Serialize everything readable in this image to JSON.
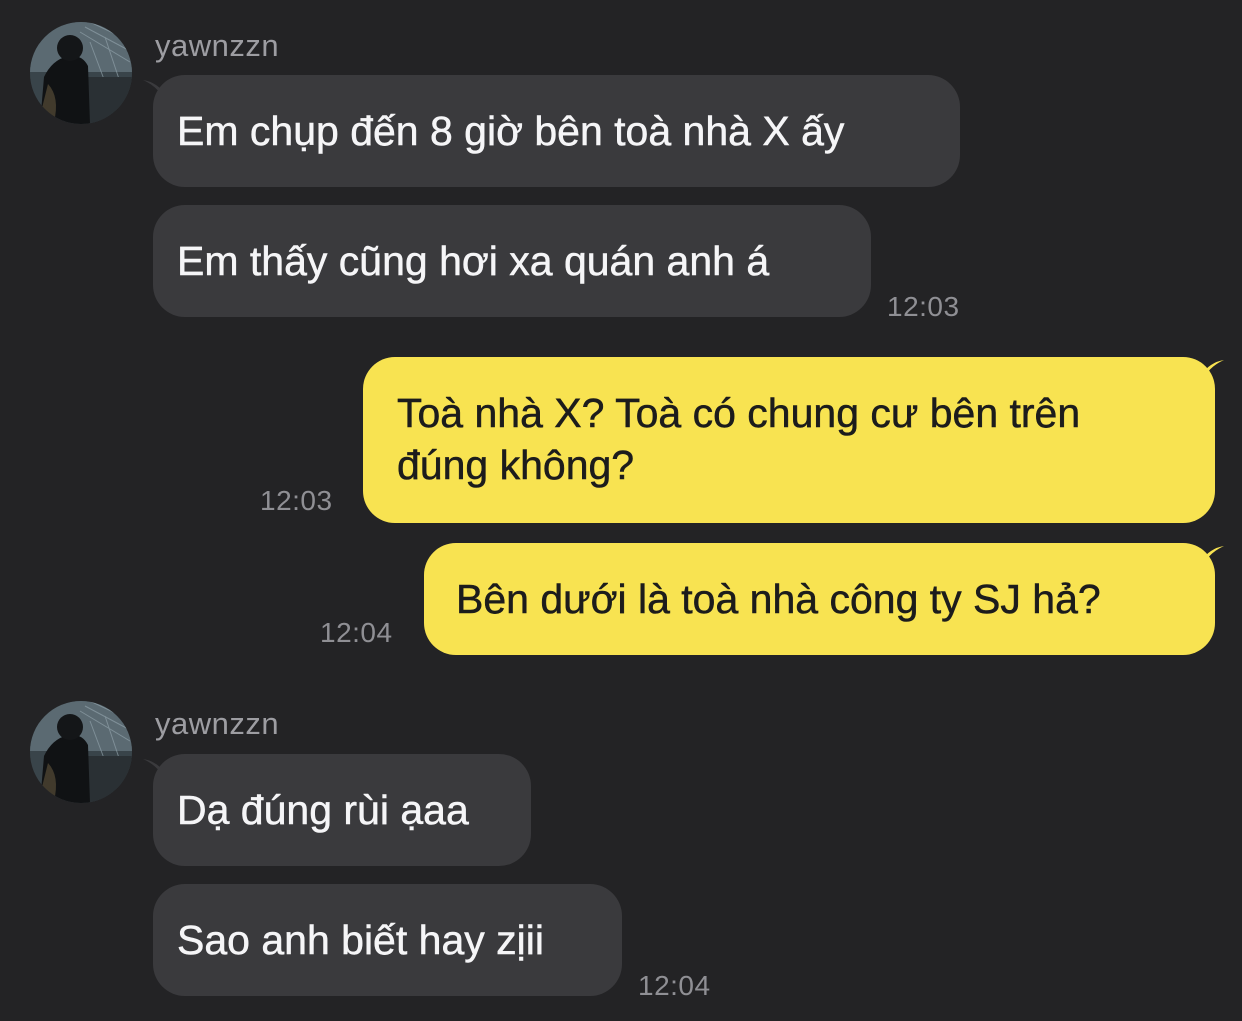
{
  "messages": [
    {
      "sender": "yawnzzn",
      "direction": "incoming",
      "bubbles": [
        "Em chụp đến 8 giờ bên toà nhà X ấy",
        "Em thấy cũng hơi xa quán anh á"
      ],
      "time": "12:03"
    },
    {
      "direction": "outgoing",
      "bubbles": [
        {
          "lines": [
            "Toà nhà X? Toà có chung cư bên trên",
            "đúng không?"
          ],
          "time": "12:03"
        },
        {
          "lines": [
            "Bên dưới là toà nhà công ty SJ hả?"
          ],
          "time": "12:04"
        }
      ]
    },
    {
      "sender": "yawnzzn",
      "direction": "incoming",
      "bubbles": [
        "Dạ đúng rùi ạaa",
        "Sao anh biết hay zịii"
      ],
      "time": "12:04"
    }
  ],
  "colors": {
    "background": "#232325",
    "incoming_bubble": "#3a3a3d",
    "outgoing_bubble": "#f8e351",
    "incoming_text": "#f5f5f7",
    "outgoing_text": "#1c1c1c",
    "meta_text": "#8f8f94"
  },
  "icons": {
    "avatar": "profile-photo-avatar"
  }
}
